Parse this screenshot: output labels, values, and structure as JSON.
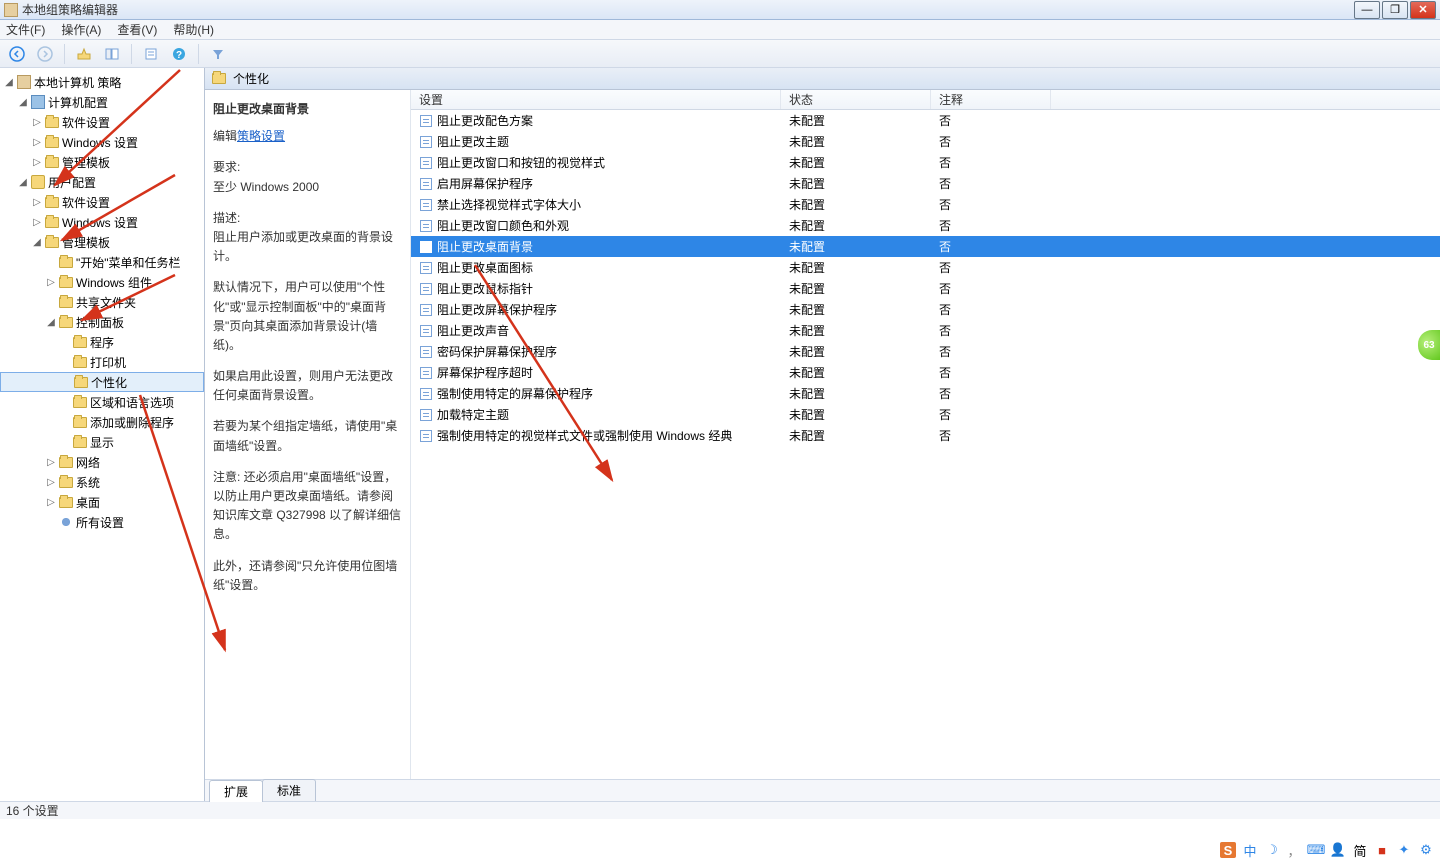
{
  "window": {
    "title": "本地组策略编辑器"
  },
  "menus": {
    "file": "文件(F)",
    "action": "操作(A)",
    "view": "查看(V)",
    "help": "帮助(H)"
  },
  "tree": {
    "root": "本地计算机 策略",
    "computer_cfg": "计算机配置",
    "cc_software": "软件设置",
    "cc_windows": "Windows 设置",
    "cc_admin": "管理模板",
    "user_cfg": "用户配置",
    "uc_software": "软件设置",
    "uc_windows": "Windows 设置",
    "uc_admin": "管理模板",
    "start_taskbar": "\"开始\"菜单和任务栏",
    "win_components": "Windows 组件",
    "shared_folders": "共享文件夹",
    "control_panel": "控制面板",
    "programs": "程序",
    "printers": "打印机",
    "personalization": "个性化",
    "region_lang": "区域和语言选项",
    "add_remove": "添加或删除程序",
    "display": "显示",
    "network": "网络",
    "system": "系统",
    "desktop": "桌面",
    "all_settings": "所有设置"
  },
  "header": {
    "title": "个性化"
  },
  "desc": {
    "setting_title": "阻止更改桌面背景",
    "edit_prefix": "编辑",
    "edit_link": "策略设置",
    "req_label": "要求:",
    "req_value": "至少 Windows 2000",
    "desc_label": "描述:",
    "p1": "阻止用户添加或更改桌面的背景设计。",
    "p2": "默认情况下，用户可以使用\"个性化\"或\"显示控制面板\"中的\"桌面背景\"页向其桌面添加背景设计(墙纸)。",
    "p3": "如果启用此设置，则用户无法更改任何桌面背景设置。",
    "p4": "若要为某个组指定墙纸，请使用\"桌面墙纸\"设置。",
    "p5": "注意: 还必须启用\"桌面墙纸\"设置，以防止用户更改桌面墙纸。请参阅知识库文章 Q327998 以了解详细信息。",
    "p6": "此外，还请参阅\"只允许使用位图墙纸\"设置。"
  },
  "columns": {
    "setting": "设置",
    "state": "状态",
    "comment": "注释"
  },
  "settings": {
    "state_unset": "未配置",
    "comment_no": "否",
    "item0": "阻止更改配色方案",
    "item1": "阻止更改主题",
    "item2": "阻止更改窗口和按钮的视觉样式",
    "item3": "启用屏幕保护程序",
    "item4": "禁止选择视觉样式字体大小",
    "item5": "阻止更改窗口颜色和外观",
    "item6": "阻止更改桌面背景",
    "item7": "阻止更改桌面图标",
    "item8": "阻止更改鼠标指针",
    "item9": "阻止更改屏幕保护程序",
    "item10": "阻止更改声音",
    "item11": "密码保护屏幕保护程序",
    "item12": "屏幕保护程序超时",
    "item13": "强制使用特定的屏幕保护程序",
    "item14": "加载特定主题",
    "item15": "强制使用特定的视觉样式文件或强制使用 Windows 经典"
  },
  "tabs": {
    "extended": "扩展",
    "standard": "标准"
  },
  "status": {
    "text": "16 个设置"
  },
  "tray": {
    "ime1": "中",
    "ime2": "简"
  },
  "badge": {
    "text": "63"
  }
}
